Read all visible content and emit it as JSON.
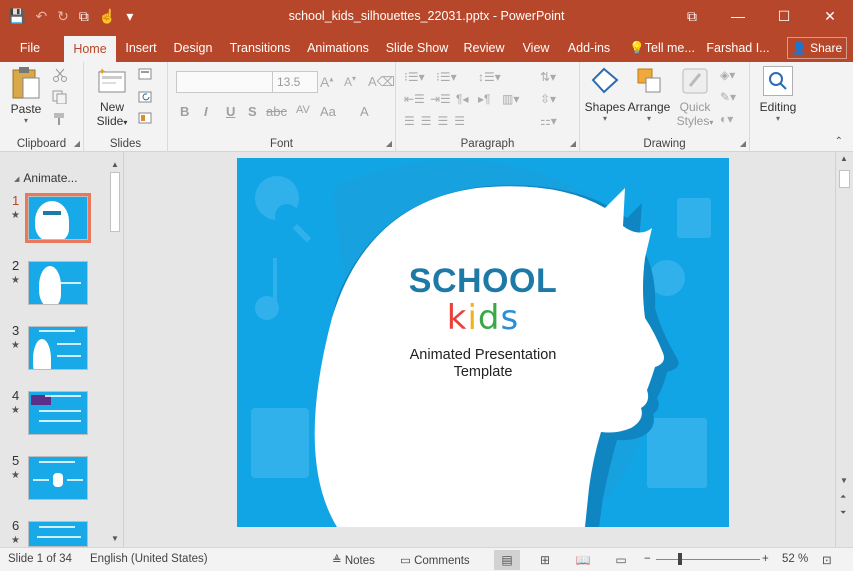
{
  "titlebar": {
    "document_title": "school_kids_silhouettes_22031.pptx - PowerPoint",
    "qat": {
      "save": "💾",
      "undo": "↶",
      "redo": "↻",
      "present": "⧉",
      "touch": "☝",
      "more": "▾"
    },
    "window_controls": {
      "ribbon_display": "⧉",
      "minimize": "—",
      "maximize": "☐",
      "close": "✕"
    }
  },
  "tabs": [
    "File",
    "Home",
    "Insert",
    "Design",
    "Transitions",
    "Animations",
    "Slide Show",
    "Review",
    "View",
    "Add-ins",
    "Tell me...",
    "Farshad I...",
    "Share"
  ],
  "ribbon": {
    "clipboard": {
      "label": "Clipboard",
      "paste": "Paste"
    },
    "slides": {
      "label": "Slides",
      "new_slide_1": "New",
      "new_slide_2": "Slide"
    },
    "font": {
      "label": "Font",
      "font_name": "",
      "font_size": "13.5",
      "bold": "B",
      "italic": "I",
      "underline": "U",
      "strike": "S",
      "spacing": "AV",
      "case": "Aa",
      "color": "A"
    },
    "paragraph": {
      "label": "Paragraph"
    },
    "drawing": {
      "label": "Drawing",
      "shapes": "Shapes",
      "arrange": "Arrange",
      "quick_styles_1": "Quick",
      "quick_styles_2": "Styles"
    },
    "editing": {
      "label": "Editing"
    }
  },
  "thumbnails": {
    "section_title": "Animate...",
    "slides": [
      {
        "num": "1",
        "star": "★"
      },
      {
        "num": "2",
        "star": "★"
      },
      {
        "num": "3",
        "star": "★"
      },
      {
        "num": "4",
        "star": "★"
      },
      {
        "num": "5",
        "star": "★"
      },
      {
        "num": "6",
        "star": "★"
      }
    ]
  },
  "slide": {
    "title_1": "SCHOOL",
    "title_2_letters": [
      "k",
      "i",
      "d",
      "s"
    ],
    "title_2_colors": [
      "#e8423a",
      "#f2b21b",
      "#3aa845",
      "#2a8fd6"
    ],
    "subtitle_1": "Animated Presentation",
    "subtitle_2": "Template"
  },
  "statusbar": {
    "slide_info": "Slide 1 of 34",
    "language": "English (United States)",
    "notes": "Notes",
    "comments": "Comments",
    "zoom_minus": "−",
    "zoom_plus": "+",
    "zoom_level": "52 %"
  }
}
